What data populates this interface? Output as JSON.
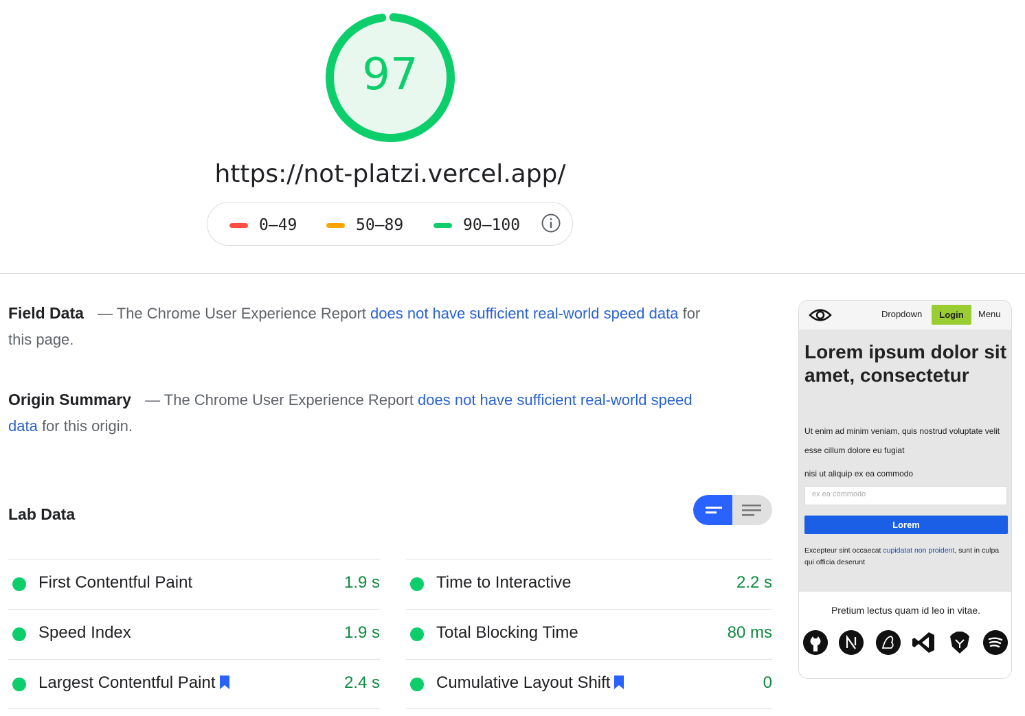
{
  "score": {
    "value": "97",
    "fraction": 0.97,
    "color": "#0cce6b"
  },
  "url": "https://not-platzi.vercel.app/",
  "legend": {
    "ranges": [
      {
        "label": "0–49",
        "color": "#ff4e42"
      },
      {
        "label": "50–89",
        "color": "#ffa400"
      },
      {
        "label": "90–100",
        "color": "#0cce6b"
      }
    ],
    "info_icon": "info-icon"
  },
  "field_data": {
    "title": "Field Data",
    "pre": "— The Chrome User Experience Report ",
    "link": "does not have sufficient real-world speed data",
    "post": " for this page."
  },
  "origin_summary": {
    "title": "Origin Summary",
    "pre": "— The Chrome User Experience Report ",
    "link": "does not have sufficient real-world speed data",
    "post": " for this origin."
  },
  "lab_data": {
    "title": "Lab Data",
    "toggle": {
      "left_icon": "summary-view-icon",
      "right_icon": "list-view-icon",
      "active": "left"
    },
    "metrics_left": [
      {
        "label": "First Contentful Paint",
        "value": "1.9 s",
        "bookmark": false
      },
      {
        "label": "Speed Index",
        "value": "1.9 s",
        "bookmark": false
      },
      {
        "label": "Largest Contentful Paint",
        "value": "2.4 s",
        "bookmark": true
      }
    ],
    "metrics_right": [
      {
        "label": "Time to Interactive",
        "value": "2.2 s",
        "bookmark": false
      },
      {
        "label": "Total Blocking Time",
        "value": "80 ms",
        "bookmark": false
      },
      {
        "label": "Cumulative Layout Shift",
        "value": "0",
        "bookmark": true
      }
    ]
  },
  "thumbnail": {
    "nav": {
      "dropdown": "Dropdown",
      "login": "Login",
      "menu": "Menu"
    },
    "heading": "Lorem ipsum dolor sit amet, consectetur",
    "paragraph1": "Ut enim ad minim veniam, quis nostrud voluptate velit esse cillum dolore eu fugiat",
    "paragraph2": "nisi ut aliquip ex ea commodo",
    "input_placeholder": "ex ea commodo",
    "button": "Lorem",
    "p3_pre": "Excepteur sint occaecat ",
    "p3_link": "cupidatat non proident",
    "p3_post": ", sunt in culpa qui officia deserunt",
    "footer": "Pretium lectus quam id leo in vitae.",
    "icons": [
      "github-icon",
      "nextjs-icon",
      "logo-icon",
      "vscode-icon",
      "brave-icon",
      "spotify-icon"
    ]
  }
}
